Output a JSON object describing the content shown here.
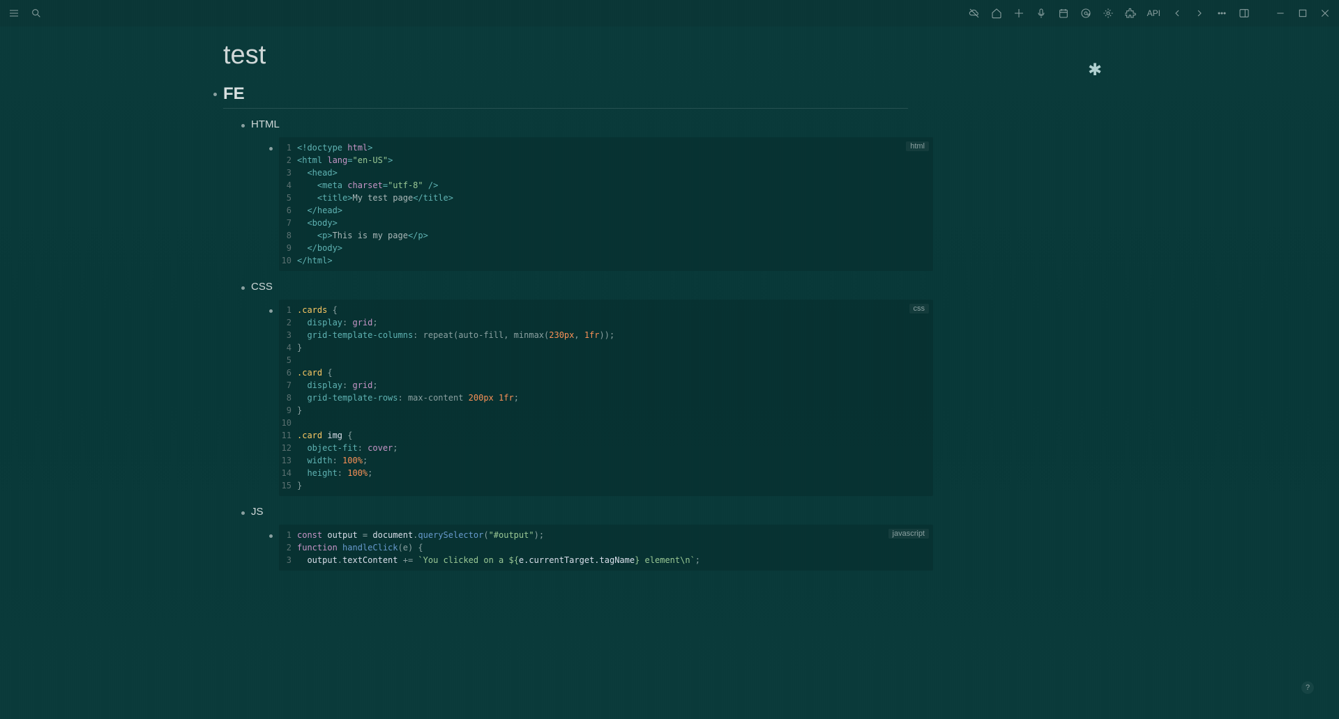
{
  "titlebar": {
    "api_label": "API"
  },
  "page": {
    "title": "test",
    "asterisk": "✱"
  },
  "outline": {
    "h1": "FE",
    "sections": [
      {
        "heading": "HTML",
        "lang": "html",
        "code": [
          [
            {
              "t": "tag",
              "s": "<!doctype "
            },
            {
              "t": "attr",
              "s": "html"
            },
            {
              "t": "tag",
              "s": ">"
            }
          ],
          [
            {
              "t": "tag",
              "s": "<html "
            },
            {
              "t": "attr",
              "s": "lang"
            },
            {
              "t": "tag",
              "s": "="
            },
            {
              "t": "str",
              "s": "\"en-US\""
            },
            {
              "t": "tag",
              "s": ">"
            }
          ],
          [
            {
              "t": "tag",
              "s": "  <head>"
            }
          ],
          [
            {
              "t": "tag",
              "s": "    <meta "
            },
            {
              "t": "attr",
              "s": "charset"
            },
            {
              "t": "tag",
              "s": "="
            },
            {
              "t": "str",
              "s": "\"utf-8\""
            },
            {
              "t": "tag",
              "s": " />"
            }
          ],
          [
            {
              "t": "tag",
              "s": "    <title>"
            },
            {
              "t": "text",
              "s": "My test page"
            },
            {
              "t": "tag",
              "s": "</title>"
            }
          ],
          [
            {
              "t": "tag",
              "s": "  </head>"
            }
          ],
          [
            {
              "t": "tag",
              "s": "  <body>"
            }
          ],
          [
            {
              "t": "tag",
              "s": "    <p>"
            },
            {
              "t": "text",
              "s": "This is my page"
            },
            {
              "t": "tag",
              "s": "</p>"
            }
          ],
          [
            {
              "t": "tag",
              "s": "  </body>"
            }
          ],
          [
            {
              "t": "tag",
              "s": "</html>"
            }
          ]
        ]
      },
      {
        "heading": "CSS",
        "lang": "css",
        "code": [
          [
            {
              "t": "class",
              "s": ".cards"
            },
            {
              "t": "punc",
              "s": " {"
            }
          ],
          [
            {
              "t": "prop",
              "s": "  display"
            },
            {
              "t": "punc",
              "s": ": "
            },
            {
              "t": "val",
              "s": "grid"
            },
            {
              "t": "punc",
              "s": ";"
            }
          ],
          [
            {
              "t": "prop",
              "s": "  grid-template-columns"
            },
            {
              "t": "punc",
              "s": ": repeat(auto-fill, minmax("
            },
            {
              "t": "num",
              "s": "230px"
            },
            {
              "t": "punc",
              "s": ", "
            },
            {
              "t": "num",
              "s": "1fr"
            },
            {
              "t": "punc",
              "s": "));"
            }
          ],
          [
            {
              "t": "punc",
              "s": "}"
            }
          ],
          [
            {
              "t": "punc",
              "s": ""
            }
          ],
          [
            {
              "t": "class",
              "s": ".card"
            },
            {
              "t": "punc",
              "s": " {"
            }
          ],
          [
            {
              "t": "prop",
              "s": "  display"
            },
            {
              "t": "punc",
              "s": ": "
            },
            {
              "t": "val",
              "s": "grid"
            },
            {
              "t": "punc",
              "s": ";"
            }
          ],
          [
            {
              "t": "prop",
              "s": "  grid-template-rows"
            },
            {
              "t": "punc",
              "s": ": max-content "
            },
            {
              "t": "num",
              "s": "200px"
            },
            {
              "t": "punc",
              "s": " "
            },
            {
              "t": "num",
              "s": "1fr"
            },
            {
              "t": "punc",
              "s": ";"
            }
          ],
          [
            {
              "t": "punc",
              "s": "}"
            }
          ],
          [
            {
              "t": "punc",
              "s": ""
            }
          ],
          [
            {
              "t": "class",
              "s": ".card"
            },
            {
              "t": "sel",
              "s": " img"
            },
            {
              "t": "punc",
              "s": " {"
            }
          ],
          [
            {
              "t": "prop",
              "s": "  object-fit"
            },
            {
              "t": "punc",
              "s": ": "
            },
            {
              "t": "val",
              "s": "cover"
            },
            {
              "t": "punc",
              "s": ";"
            }
          ],
          [
            {
              "t": "prop",
              "s": "  width"
            },
            {
              "t": "punc",
              "s": ": "
            },
            {
              "t": "num",
              "s": "100%"
            },
            {
              "t": "punc",
              "s": ";"
            }
          ],
          [
            {
              "t": "prop",
              "s": "  height"
            },
            {
              "t": "punc",
              "s": ": "
            },
            {
              "t": "num",
              "s": "100%"
            },
            {
              "t": "punc",
              "s": ";"
            }
          ],
          [
            {
              "t": "punc",
              "s": "}"
            }
          ]
        ]
      },
      {
        "heading": "JS",
        "lang": "javascript",
        "code": [
          [
            {
              "t": "kw",
              "s": "const"
            },
            {
              "t": "var",
              "s": " output "
            },
            {
              "t": "punc",
              "s": "= "
            },
            {
              "t": "var",
              "s": "document"
            },
            {
              "t": "punc",
              "s": "."
            },
            {
              "t": "fn",
              "s": "querySelector"
            },
            {
              "t": "punc",
              "s": "("
            },
            {
              "t": "str",
              "s": "\"#output\""
            },
            {
              "t": "punc",
              "s": ");"
            }
          ],
          [
            {
              "t": "kw",
              "s": "function"
            },
            {
              "t": "fn",
              "s": " handleClick"
            },
            {
              "t": "punc",
              "s": "(e) {"
            }
          ],
          [
            {
              "t": "var",
              "s": "  output"
            },
            {
              "t": "punc",
              "s": "."
            },
            {
              "t": "var",
              "s": "textContent "
            },
            {
              "t": "punc",
              "s": "+= "
            },
            {
              "t": "str",
              "s": "`You clicked on a ${"
            },
            {
              "t": "var",
              "s": "e.currentTarget.tagName"
            },
            {
              "t": "str",
              "s": "} element\\n`"
            },
            {
              "t": "punc",
              "s": ";"
            }
          ]
        ]
      }
    ]
  },
  "help": "?"
}
